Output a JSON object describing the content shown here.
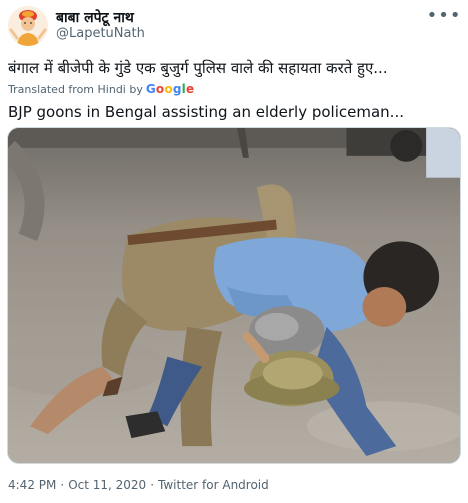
{
  "tweet": {
    "display_name": "बाबा लपेटू नाथ",
    "handle": "@LapetuNath",
    "text_original": "बंगाल में बीजेपी के गुंडे एक बुजुर्ग पुलिस वाले की सहायता करते हुए...",
    "translated_from": "Translated from Hindi by",
    "translator_brand": [
      "G",
      "o",
      "o",
      "g",
      "l",
      "e"
    ],
    "text_translated": "BJP goons in Bengal assisting an elderly policeman...",
    "time": "4:42 PM",
    "date": "Oct 11, 2020",
    "source": "Twitter for Android",
    "separator": "·"
  },
  "icons": {
    "more": "more-options-icon"
  },
  "colors": {
    "text": "#0f1419",
    "secondary": "#536471",
    "border": "#cfd9de"
  }
}
